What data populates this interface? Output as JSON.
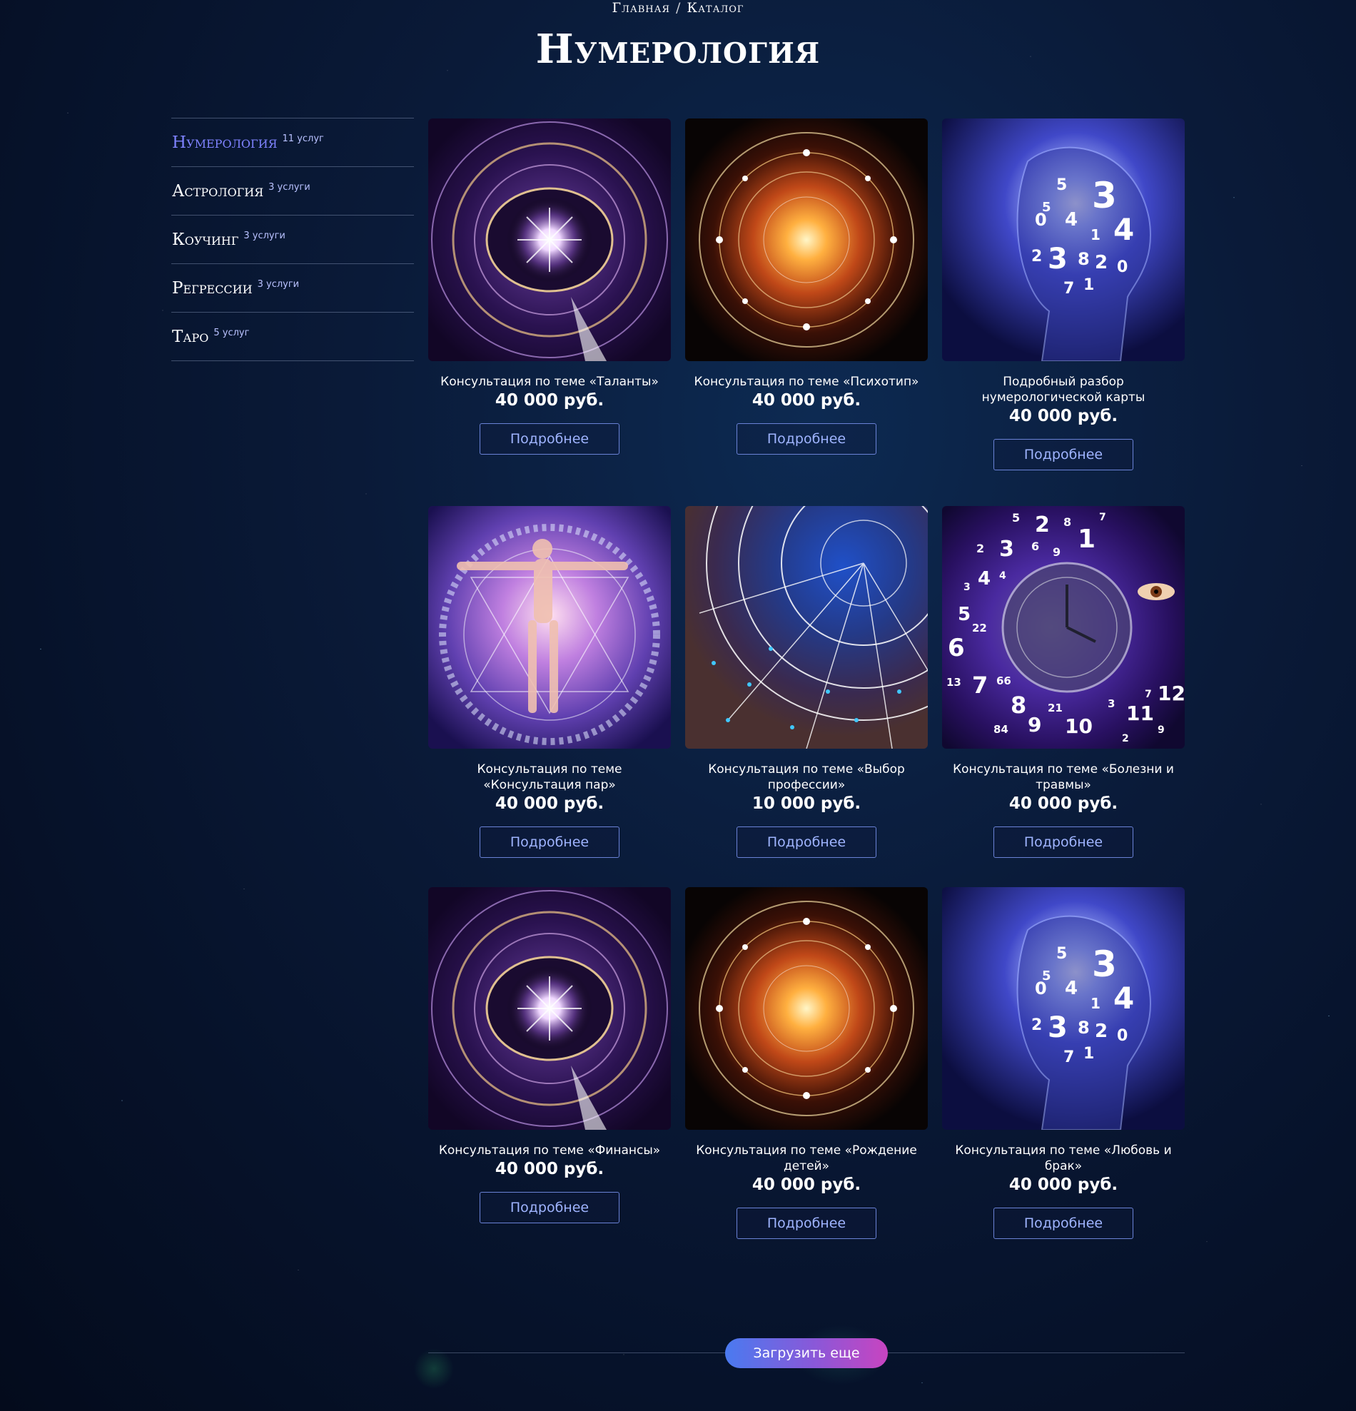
{
  "breadcrumb": {
    "home": "Главная",
    "separator": "/",
    "current": "Каталог"
  },
  "page_title": "Нумерология",
  "sidebar": {
    "items": [
      {
        "label": "Нумерология",
        "count": "11 услуг",
        "active": true
      },
      {
        "label": "Астрология",
        "count": "3 услуги",
        "active": false
      },
      {
        "label": "Коучинг",
        "count": "3 услуги",
        "active": false
      },
      {
        "label": "Регрессии",
        "count": "3 услуги",
        "active": false
      },
      {
        "label": "Таро",
        "count": "5 услуг",
        "active": false
      }
    ]
  },
  "cards": [
    {
      "title": "Консультация по теме «Таланты»",
      "price": "40 000 руб.",
      "button": "Подробнее",
      "image": "zodiac-sun-wheel"
    },
    {
      "title": "Консультация по теме «Психотип»",
      "price": "40 000 руб.",
      "button": "Подробнее",
      "image": "fiery-astro-circle"
    },
    {
      "title": "Подробный разбор нумерологической карты",
      "price": "40 000 руб.",
      "button": "Подробнее",
      "image": "numbers-head"
    },
    {
      "title": "Консультация по теме «Консультация пар»",
      "price": "40 000 руб.",
      "button": "Подробнее",
      "image": "vitruvian-couple"
    },
    {
      "title": "Консультация по теме «Выбор профессии»",
      "price": "10 000 руб.",
      "button": "Подробнее",
      "image": "zodiac-map"
    },
    {
      "title": "Консультация по теме «Болезни и травмы»",
      "price": "40 000 руб.",
      "button": "Подробнее",
      "image": "eye-clock-numbers"
    },
    {
      "title": "Консультация по теме «Финансы»",
      "price": "40 000 руб.",
      "button": "Подробнее",
      "image": "zodiac-sun-wheel"
    },
    {
      "title": "Консультация по теме «Рождение детей»",
      "price": "40 000 руб.",
      "button": "Подробнее",
      "image": "fiery-astro-circle"
    },
    {
      "title": "Консультация по теме «Любовь и брак»",
      "price": "40 000 руб.",
      "button": "Подробнее",
      "image": "numbers-head"
    }
  ],
  "load_more": {
    "label": "Загрузить еще"
  },
  "colors": {
    "accent": "#7f83ff",
    "button_border": "#6a82d6",
    "button_text": "#9fb4ff",
    "load_more_gradient": [
      "#4a7af0",
      "#8a58d8",
      "#c844c0"
    ]
  },
  "image_text": {
    "numbers_head": [
      "3",
      "4",
      "0",
      "1",
      "5",
      "2",
      "3",
      "8",
      "2",
      "0",
      "7",
      "1",
      "5",
      "4"
    ],
    "eye_clock": [
      "5",
      "2",
      "8",
      "1",
      "7",
      "2",
      "3",
      "6",
      "9",
      "3",
      "4",
      "4",
      "5",
      "22",
      "6",
      "13",
      "7",
      "66",
      "8",
      "84",
      "9",
      "21",
      "10",
      "3",
      "11",
      "7",
      "12",
      "2",
      "9"
    ]
  }
}
